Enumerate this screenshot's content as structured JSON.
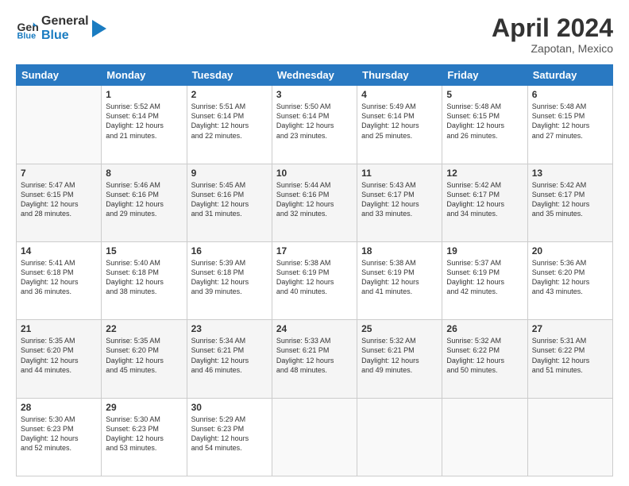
{
  "header": {
    "logo_general": "General",
    "logo_blue": "Blue",
    "month_year": "April 2024",
    "location": "Zapotan, Mexico"
  },
  "days_of_week": [
    "Sunday",
    "Monday",
    "Tuesday",
    "Wednesday",
    "Thursday",
    "Friday",
    "Saturday"
  ],
  "weeks": [
    [
      {
        "day": "",
        "text": ""
      },
      {
        "day": "1",
        "text": "Sunrise: 5:52 AM\nSunset: 6:14 PM\nDaylight: 12 hours\nand 21 minutes."
      },
      {
        "day": "2",
        "text": "Sunrise: 5:51 AM\nSunset: 6:14 PM\nDaylight: 12 hours\nand 22 minutes."
      },
      {
        "day": "3",
        "text": "Sunrise: 5:50 AM\nSunset: 6:14 PM\nDaylight: 12 hours\nand 23 minutes."
      },
      {
        "day": "4",
        "text": "Sunrise: 5:49 AM\nSunset: 6:14 PM\nDaylight: 12 hours\nand 25 minutes."
      },
      {
        "day": "5",
        "text": "Sunrise: 5:48 AM\nSunset: 6:15 PM\nDaylight: 12 hours\nand 26 minutes."
      },
      {
        "day": "6",
        "text": "Sunrise: 5:48 AM\nSunset: 6:15 PM\nDaylight: 12 hours\nand 27 minutes."
      }
    ],
    [
      {
        "day": "7",
        "text": "Sunrise: 5:47 AM\nSunset: 6:15 PM\nDaylight: 12 hours\nand 28 minutes."
      },
      {
        "day": "8",
        "text": "Sunrise: 5:46 AM\nSunset: 6:16 PM\nDaylight: 12 hours\nand 29 minutes."
      },
      {
        "day": "9",
        "text": "Sunrise: 5:45 AM\nSunset: 6:16 PM\nDaylight: 12 hours\nand 31 minutes."
      },
      {
        "day": "10",
        "text": "Sunrise: 5:44 AM\nSunset: 6:16 PM\nDaylight: 12 hours\nand 32 minutes."
      },
      {
        "day": "11",
        "text": "Sunrise: 5:43 AM\nSunset: 6:17 PM\nDaylight: 12 hours\nand 33 minutes."
      },
      {
        "day": "12",
        "text": "Sunrise: 5:42 AM\nSunset: 6:17 PM\nDaylight: 12 hours\nand 34 minutes."
      },
      {
        "day": "13",
        "text": "Sunrise: 5:42 AM\nSunset: 6:17 PM\nDaylight: 12 hours\nand 35 minutes."
      }
    ],
    [
      {
        "day": "14",
        "text": "Sunrise: 5:41 AM\nSunset: 6:18 PM\nDaylight: 12 hours\nand 36 minutes."
      },
      {
        "day": "15",
        "text": "Sunrise: 5:40 AM\nSunset: 6:18 PM\nDaylight: 12 hours\nand 38 minutes."
      },
      {
        "day": "16",
        "text": "Sunrise: 5:39 AM\nSunset: 6:18 PM\nDaylight: 12 hours\nand 39 minutes."
      },
      {
        "day": "17",
        "text": "Sunrise: 5:38 AM\nSunset: 6:19 PM\nDaylight: 12 hours\nand 40 minutes."
      },
      {
        "day": "18",
        "text": "Sunrise: 5:38 AM\nSunset: 6:19 PM\nDaylight: 12 hours\nand 41 minutes."
      },
      {
        "day": "19",
        "text": "Sunrise: 5:37 AM\nSunset: 6:19 PM\nDaylight: 12 hours\nand 42 minutes."
      },
      {
        "day": "20",
        "text": "Sunrise: 5:36 AM\nSunset: 6:20 PM\nDaylight: 12 hours\nand 43 minutes."
      }
    ],
    [
      {
        "day": "21",
        "text": "Sunrise: 5:35 AM\nSunset: 6:20 PM\nDaylight: 12 hours\nand 44 minutes."
      },
      {
        "day": "22",
        "text": "Sunrise: 5:35 AM\nSunset: 6:20 PM\nDaylight: 12 hours\nand 45 minutes."
      },
      {
        "day": "23",
        "text": "Sunrise: 5:34 AM\nSunset: 6:21 PM\nDaylight: 12 hours\nand 46 minutes."
      },
      {
        "day": "24",
        "text": "Sunrise: 5:33 AM\nSunset: 6:21 PM\nDaylight: 12 hours\nand 48 minutes."
      },
      {
        "day": "25",
        "text": "Sunrise: 5:32 AM\nSunset: 6:21 PM\nDaylight: 12 hours\nand 49 minutes."
      },
      {
        "day": "26",
        "text": "Sunrise: 5:32 AM\nSunset: 6:22 PM\nDaylight: 12 hours\nand 50 minutes."
      },
      {
        "day": "27",
        "text": "Sunrise: 5:31 AM\nSunset: 6:22 PM\nDaylight: 12 hours\nand 51 minutes."
      }
    ],
    [
      {
        "day": "28",
        "text": "Sunrise: 5:30 AM\nSunset: 6:23 PM\nDaylight: 12 hours\nand 52 minutes."
      },
      {
        "day": "29",
        "text": "Sunrise: 5:30 AM\nSunset: 6:23 PM\nDaylight: 12 hours\nand 53 minutes."
      },
      {
        "day": "30",
        "text": "Sunrise: 5:29 AM\nSunset: 6:23 PM\nDaylight: 12 hours\nand 54 minutes."
      },
      {
        "day": "",
        "text": ""
      },
      {
        "day": "",
        "text": ""
      },
      {
        "day": "",
        "text": ""
      },
      {
        "day": "",
        "text": ""
      }
    ]
  ]
}
